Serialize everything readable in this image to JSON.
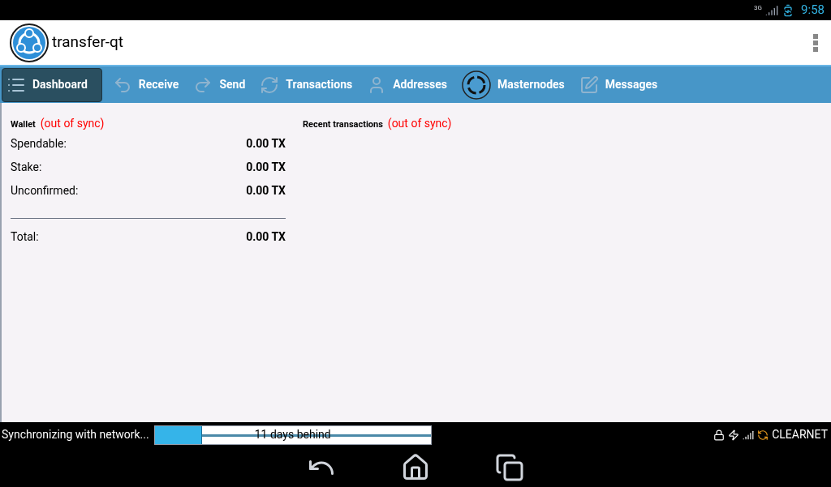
{
  "status_bar": {
    "network": "3G",
    "time": "9:58"
  },
  "app_bar": {
    "title": "transfer-qt"
  },
  "tabs": [
    {
      "label": "Dashboard",
      "kind": "dashboard",
      "selected": true
    },
    {
      "label": "Receive",
      "kind": "receive",
      "selected": false
    },
    {
      "label": "Send",
      "kind": "send",
      "selected": false
    },
    {
      "label": "Transactions",
      "kind": "transactions",
      "selected": false
    },
    {
      "label": "Addresses",
      "kind": "addresses",
      "selected": false
    },
    {
      "label": "Masternodes",
      "kind": "masternodes",
      "selected": false
    },
    {
      "label": "Messages",
      "kind": "messages",
      "selected": false
    }
  ],
  "wallet": {
    "title": "Wallet",
    "sync_warning": "(out of sync)",
    "rows": [
      {
        "label": "Spendable:",
        "value": "0.00 TX"
      },
      {
        "label": "Stake:",
        "value": "0.00 TX"
      },
      {
        "label": "Unconfirmed:",
        "value": "0.00 TX"
      }
    ],
    "total": {
      "label": "Total:",
      "value": "0.00 TX"
    }
  },
  "recent_transactions": {
    "title": "Recent transactions",
    "sync_warning": "(out of sync)"
  },
  "sync_bar": {
    "message": "Synchronizing with network...",
    "progress": {
      "level": 0.17,
      "text": "11 days behind"
    },
    "network_label": "CLEARNET"
  }
}
